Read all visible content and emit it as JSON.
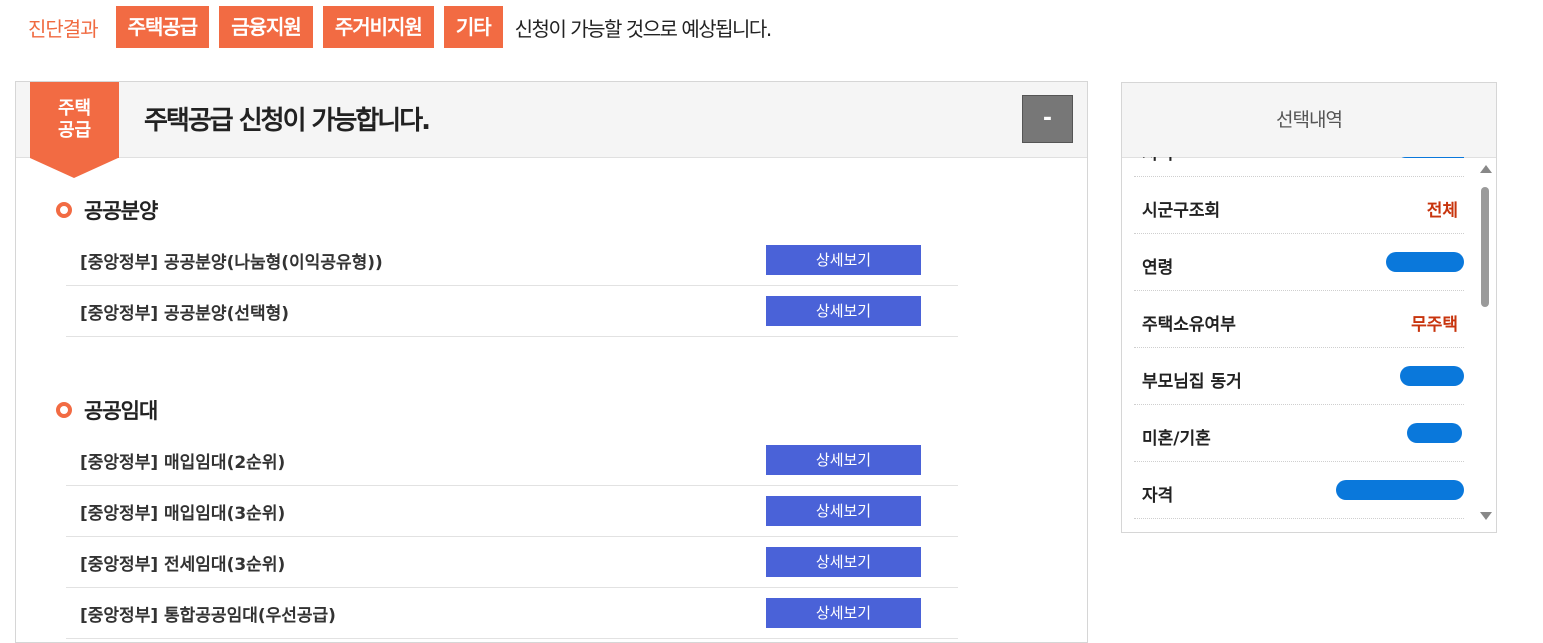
{
  "result": {
    "title": "진단결과",
    "categories": [
      "주택공급",
      "금융지원",
      "주거비지원",
      "기타"
    ],
    "suffix": "신청이 가능할 것으로 예상됩니다."
  },
  "main": {
    "ribbon_line1": "주택",
    "ribbon_line2": "공급",
    "title": "주택공급 신청이 가능합니다.",
    "collapse_label": "-",
    "sections": [
      {
        "title": "공공분양",
        "items": [
          {
            "label": "[중앙정부] 공공분양(나눔형(이익공유형))",
            "button": "상세보기"
          },
          {
            "label": "[중앙정부] 공공분양(선택형)",
            "button": "상세보기"
          }
        ]
      },
      {
        "title": "공공임대",
        "items": [
          {
            "label": "[중앙정부] 매입임대(2순위)",
            "button": "상세보기"
          },
          {
            "label": "[중앙정부] 매입임대(3순위)",
            "button": "상세보기"
          },
          {
            "label": "[중앙정부] 전세임대(3순위)",
            "button": "상세보기"
          },
          {
            "label": "[중앙정부] 통합공공임대(우선공급)",
            "button": "상세보기"
          }
        ]
      }
    ]
  },
  "side": {
    "title": "선택내역",
    "rows": [
      {
        "label": "지역",
        "value": ""
      },
      {
        "label": "시군구조회",
        "value": "전체"
      },
      {
        "label": "연령",
        "value": ""
      },
      {
        "label": "주택소유여부",
        "value": "무주택"
      },
      {
        "label": "부모님집 동거",
        "value": ""
      },
      {
        "label": "미혼/기혼",
        "value": ""
      },
      {
        "label": "자격",
        "value": ""
      }
    ]
  }
}
